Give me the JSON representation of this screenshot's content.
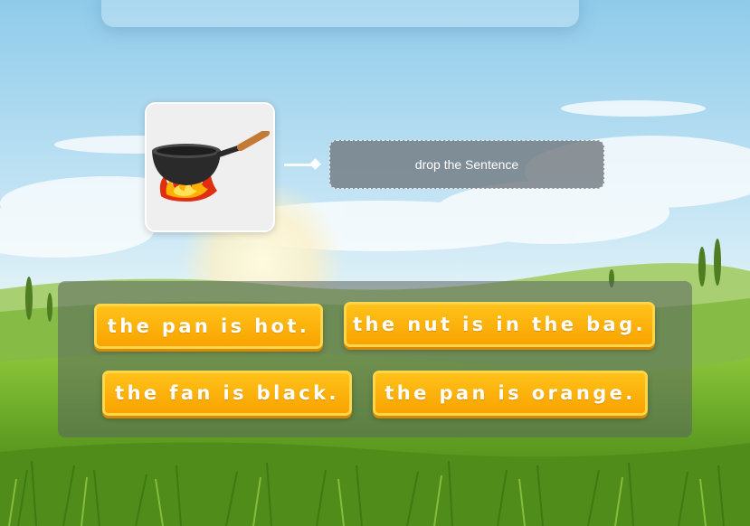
{
  "picture": {
    "icon": "wok-pan-on-fire-icon"
  },
  "drop_zone": {
    "label": "drop the Sentence"
  },
  "options": [
    {
      "label": "the pan is hot."
    },
    {
      "label": "the nut is in the bag."
    },
    {
      "label": "the fan is black."
    },
    {
      "label": "the pan is orange."
    }
  ],
  "colors": {
    "button": "#fbb100",
    "button_border": "#ffd54a",
    "drop_zone": "#6e767c",
    "sky": "#bfe4f6",
    "grass": "#6aa82a"
  }
}
